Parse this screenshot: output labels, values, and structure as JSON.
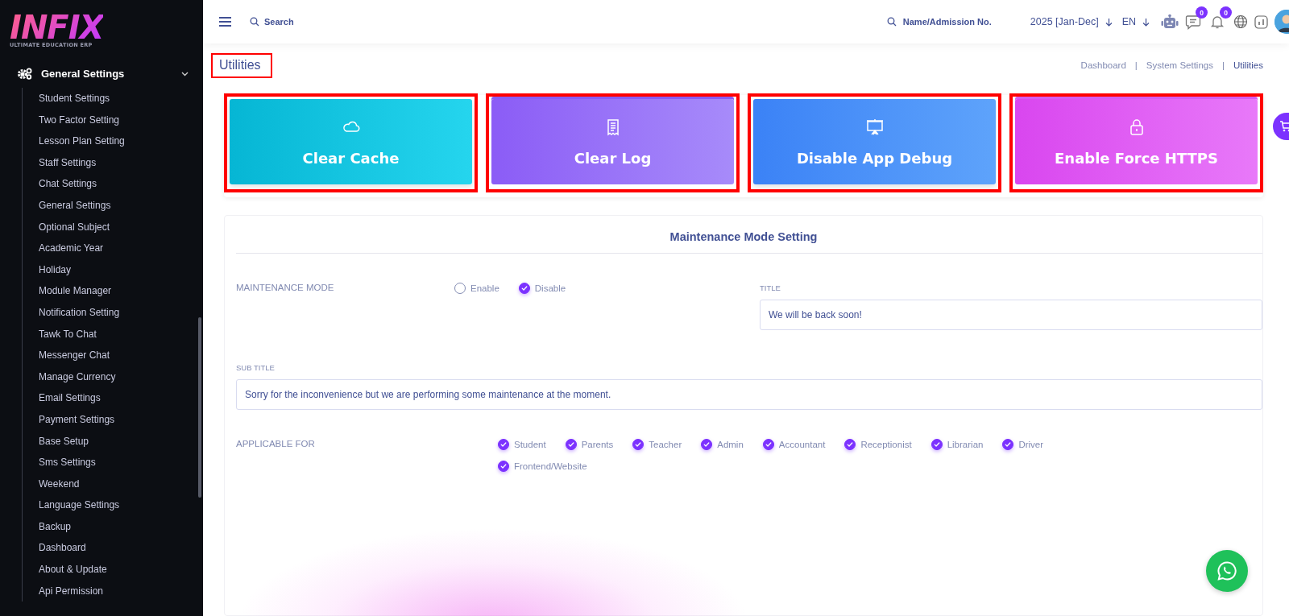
{
  "logo": {
    "wordmark": "INFIX",
    "tagline": "ULTIMATE EDUCATION ERP"
  },
  "sidebar": {
    "section": {
      "label": "General Settings",
      "expanded": true
    },
    "items": [
      {
        "label": "Student Settings"
      },
      {
        "label": "Two Factor Setting"
      },
      {
        "label": "Lesson Plan Setting"
      },
      {
        "label": "Staff Settings"
      },
      {
        "label": "Chat Settings"
      },
      {
        "label": "General Settings"
      },
      {
        "label": "Optional Subject"
      },
      {
        "label": "Academic Year"
      },
      {
        "label": "Holiday"
      },
      {
        "label": "Module Manager"
      },
      {
        "label": "Notification Setting"
      },
      {
        "label": "Tawk To Chat"
      },
      {
        "label": "Messenger Chat"
      },
      {
        "label": "Manage Currency"
      },
      {
        "label": "Email Settings"
      },
      {
        "label": "Payment Settings"
      },
      {
        "label": "Base Setup"
      },
      {
        "label": "Sms Settings"
      },
      {
        "label": "Weekend"
      },
      {
        "label": "Language Settings"
      },
      {
        "label": "Backup"
      },
      {
        "label": "Dashboard"
      },
      {
        "label": "About & Update"
      },
      {
        "label": "Api Permission"
      }
    ]
  },
  "topbar": {
    "search": {
      "placeholder": "Search"
    },
    "student_search": {
      "placeholder": "Name/Admission No."
    },
    "session": "2025 [Jan-Dec]",
    "language": "EN",
    "chat_count": "0",
    "notification_count": "0"
  },
  "page": {
    "title": "Utilities",
    "highlighted": true
  },
  "breadcrumb": [
    {
      "kind": "link",
      "label": "Dashboard",
      "selected": false
    },
    {
      "kind": "separator",
      "label": "|"
    },
    {
      "kind": "link",
      "label": "System Settings",
      "selected": false
    },
    {
      "kind": "separator",
      "label": "|"
    },
    {
      "kind": "link",
      "label": "Utilities",
      "selected": true
    }
  ],
  "actions": [
    {
      "label": "Clear Cache",
      "kind": "cache",
      "highlighted": true
    },
    {
      "label": "Clear Log",
      "kind": "log",
      "highlighted": true
    },
    {
      "label": "Disable App Debug",
      "kind": "debug",
      "highlighted": true
    },
    {
      "label": "Enable Force HTTPS",
      "kind": "https",
      "highlighted": true
    }
  ],
  "maintenance": {
    "heading": "Maintenance Mode Setting",
    "mode": {
      "label": "MAINTENANCE MODE",
      "options": [
        {
          "label": "Enable",
          "selected": false
        },
        {
          "label": "Disable",
          "selected": true
        }
      ]
    },
    "title": {
      "label": "TITLE",
      "value": "We will be back soon!"
    },
    "sub_title": {
      "label": "SUB TITLE",
      "value": "Sorry for the inconvenience but we are performing some maintenance at the moment."
    },
    "applicable_for": {
      "label": "APPLICABLE FOR",
      "options": [
        {
          "label": "Student",
          "checked": true
        },
        {
          "label": "Parents",
          "checked": true
        },
        {
          "label": "Teacher",
          "checked": true
        },
        {
          "label": "Admin",
          "checked": true
        },
        {
          "label": "Accountant",
          "checked": true
        },
        {
          "label": "Receptionist",
          "checked": true
        },
        {
          "label": "Librarian",
          "checked": true
        },
        {
          "label": "Driver",
          "checked": true
        },
        {
          "label": "Frontend/Website",
          "checked": true
        }
      ]
    }
  }
}
